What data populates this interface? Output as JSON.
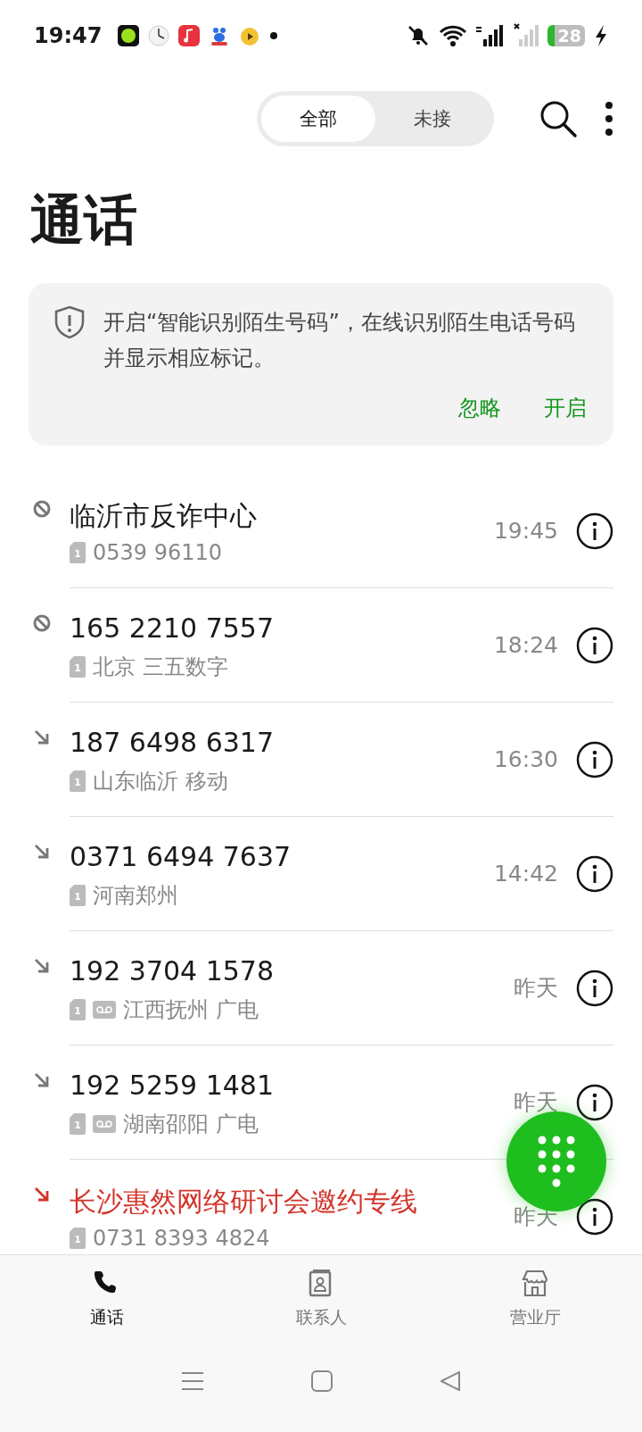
{
  "status_bar": {
    "time": "19:47",
    "battery": "28"
  },
  "filter_tabs": [
    {
      "label": "全部",
      "selected": true
    },
    {
      "label": "未接",
      "selected": false
    }
  ],
  "title": "通话",
  "banner": {
    "text": "开启“智能识别陌生号码”，在线识别陌生电话号码并显示相应标记。",
    "actions": [
      "忽略",
      "开启"
    ]
  },
  "calls": [
    {
      "kind": "blocked",
      "name": "临沂市反诈中心",
      "sim": "1",
      "voicemail": false,
      "detail": "0539 96110",
      "time": "19:45"
    },
    {
      "kind": "blocked",
      "name": "165 2210 7557",
      "sim": "1",
      "voicemail": false,
      "detail": "北京 三五数字",
      "time": "18:24"
    },
    {
      "kind": "incoming",
      "name": "187 6498 6317",
      "sim": "1",
      "voicemail": false,
      "detail": "山东临沂 移动",
      "time": "16:30"
    },
    {
      "kind": "incoming",
      "name": "0371 6494 7637",
      "sim": "1",
      "voicemail": false,
      "detail": "河南郑州",
      "time": "14:42"
    },
    {
      "kind": "incoming",
      "name": "192 3704 1578",
      "sim": "1",
      "voicemail": true,
      "detail": "江西抚州 广电",
      "time": "昨天"
    },
    {
      "kind": "incoming",
      "name": "192 5259 1481",
      "sim": "1",
      "voicemail": true,
      "detail": "湖南邵阳 广电",
      "time": "昨天"
    },
    {
      "kind": "missed",
      "name": "长沙惠然网络研讨会邀约专线",
      "sim": "1",
      "voicemail": false,
      "detail": "0731 8393 4824",
      "time": "昨天"
    }
  ],
  "bottom_nav": [
    {
      "kind": "calls",
      "label": "通话",
      "selected": true
    },
    {
      "kind": "contacts",
      "label": "联系人",
      "selected": false
    },
    {
      "kind": "store",
      "label": "营业厅",
      "selected": false
    }
  ]
}
